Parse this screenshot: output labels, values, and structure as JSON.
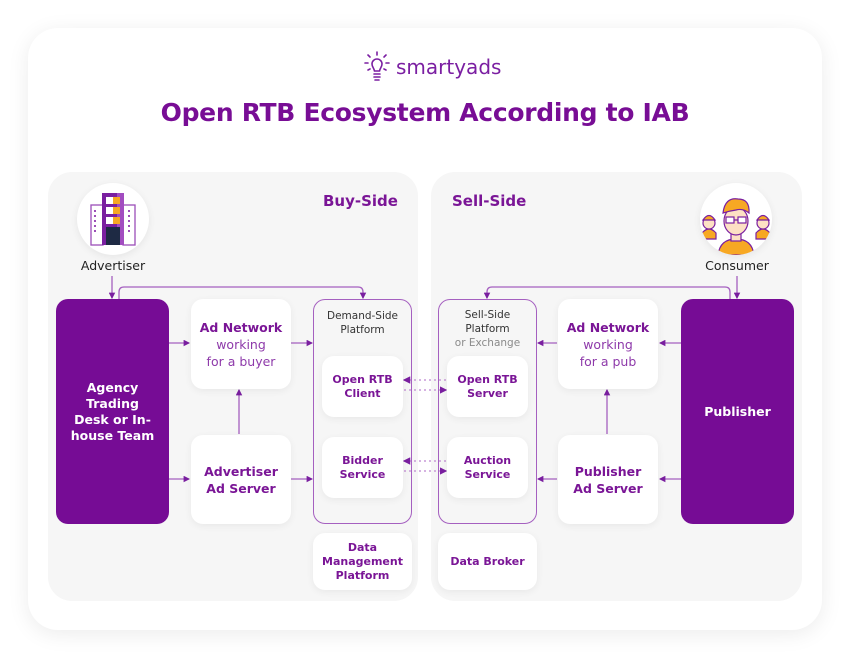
{
  "brand": {
    "name": "smartyads",
    "icon": "lightbulb-icon",
    "color": "#7b1fa2"
  },
  "title": "Open RTB Ecosystem According to IAB",
  "colors": {
    "accent": "#760c95",
    "panel": "#f6f6f6",
    "connector": "#a560c0",
    "highlight": "#f7a823"
  },
  "buy_side": {
    "label": "Buy-Side",
    "actor": {
      "label": "Advertiser",
      "icon": "building-icon"
    },
    "main_box": "Agency Trading Desk or In-house Team",
    "ad_network": {
      "title": "Ad Network",
      "line1": "working",
      "line2": "for a buyer"
    },
    "ad_server": {
      "line1": "Advertiser",
      "line2": "Ad Server"
    },
    "platform": {
      "line1": "Demand-Side",
      "line2": "Platform",
      "modules": [
        {
          "line1": "Open RTB",
          "line2": "Client"
        },
        {
          "line1": "Bidder",
          "line2": "Service"
        }
      ]
    },
    "data_box": {
      "line1": "Data",
      "line2": "Management",
      "line3": "Platform"
    }
  },
  "sell_side": {
    "label": "Sell-Side",
    "actor": {
      "label": "Consumer",
      "icon": "consumer-group-icon"
    },
    "main_box": "Publisher",
    "ad_network": {
      "title": "Ad Network",
      "line1": "working",
      "line2": "for a pub"
    },
    "ad_server": {
      "line1": "Publisher",
      "line2": "Ad Server"
    },
    "platform": {
      "line1": "Sell-Side",
      "line2": "Platform",
      "line3": "or Exchange",
      "modules": [
        {
          "line1": "Open RTB",
          "line2": "Server"
        },
        {
          "line1": "Auction",
          "line2": "Service"
        }
      ]
    },
    "data_box": {
      "line1": "Data Broker"
    }
  }
}
